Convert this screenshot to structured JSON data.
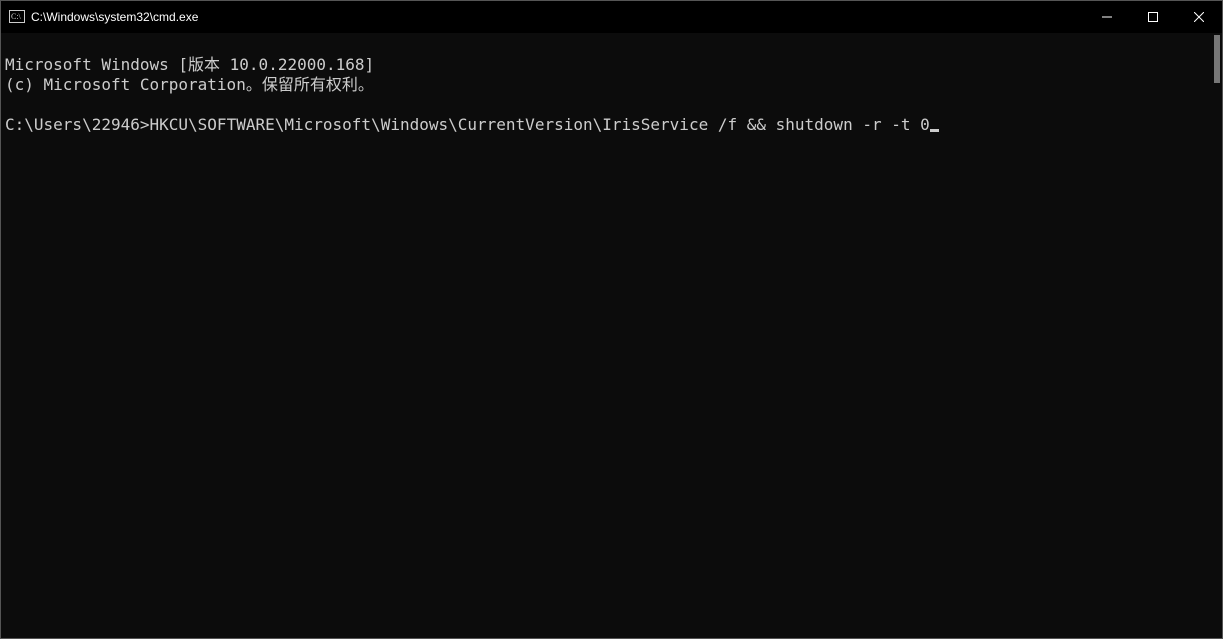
{
  "window": {
    "title": "C:\\Windows\\system32\\cmd.exe"
  },
  "terminal": {
    "line1": "Microsoft Windows [版本 10.0.22000.168]",
    "line2": "(c) Microsoft Corporation。保留所有权利。",
    "blank": "",
    "prompt": "C:\\Users\\22946>",
    "command": "HKCU\\SOFTWARE\\Microsoft\\Windows\\CurrentVersion\\IrisService /f && shutdown -r -t 0"
  }
}
